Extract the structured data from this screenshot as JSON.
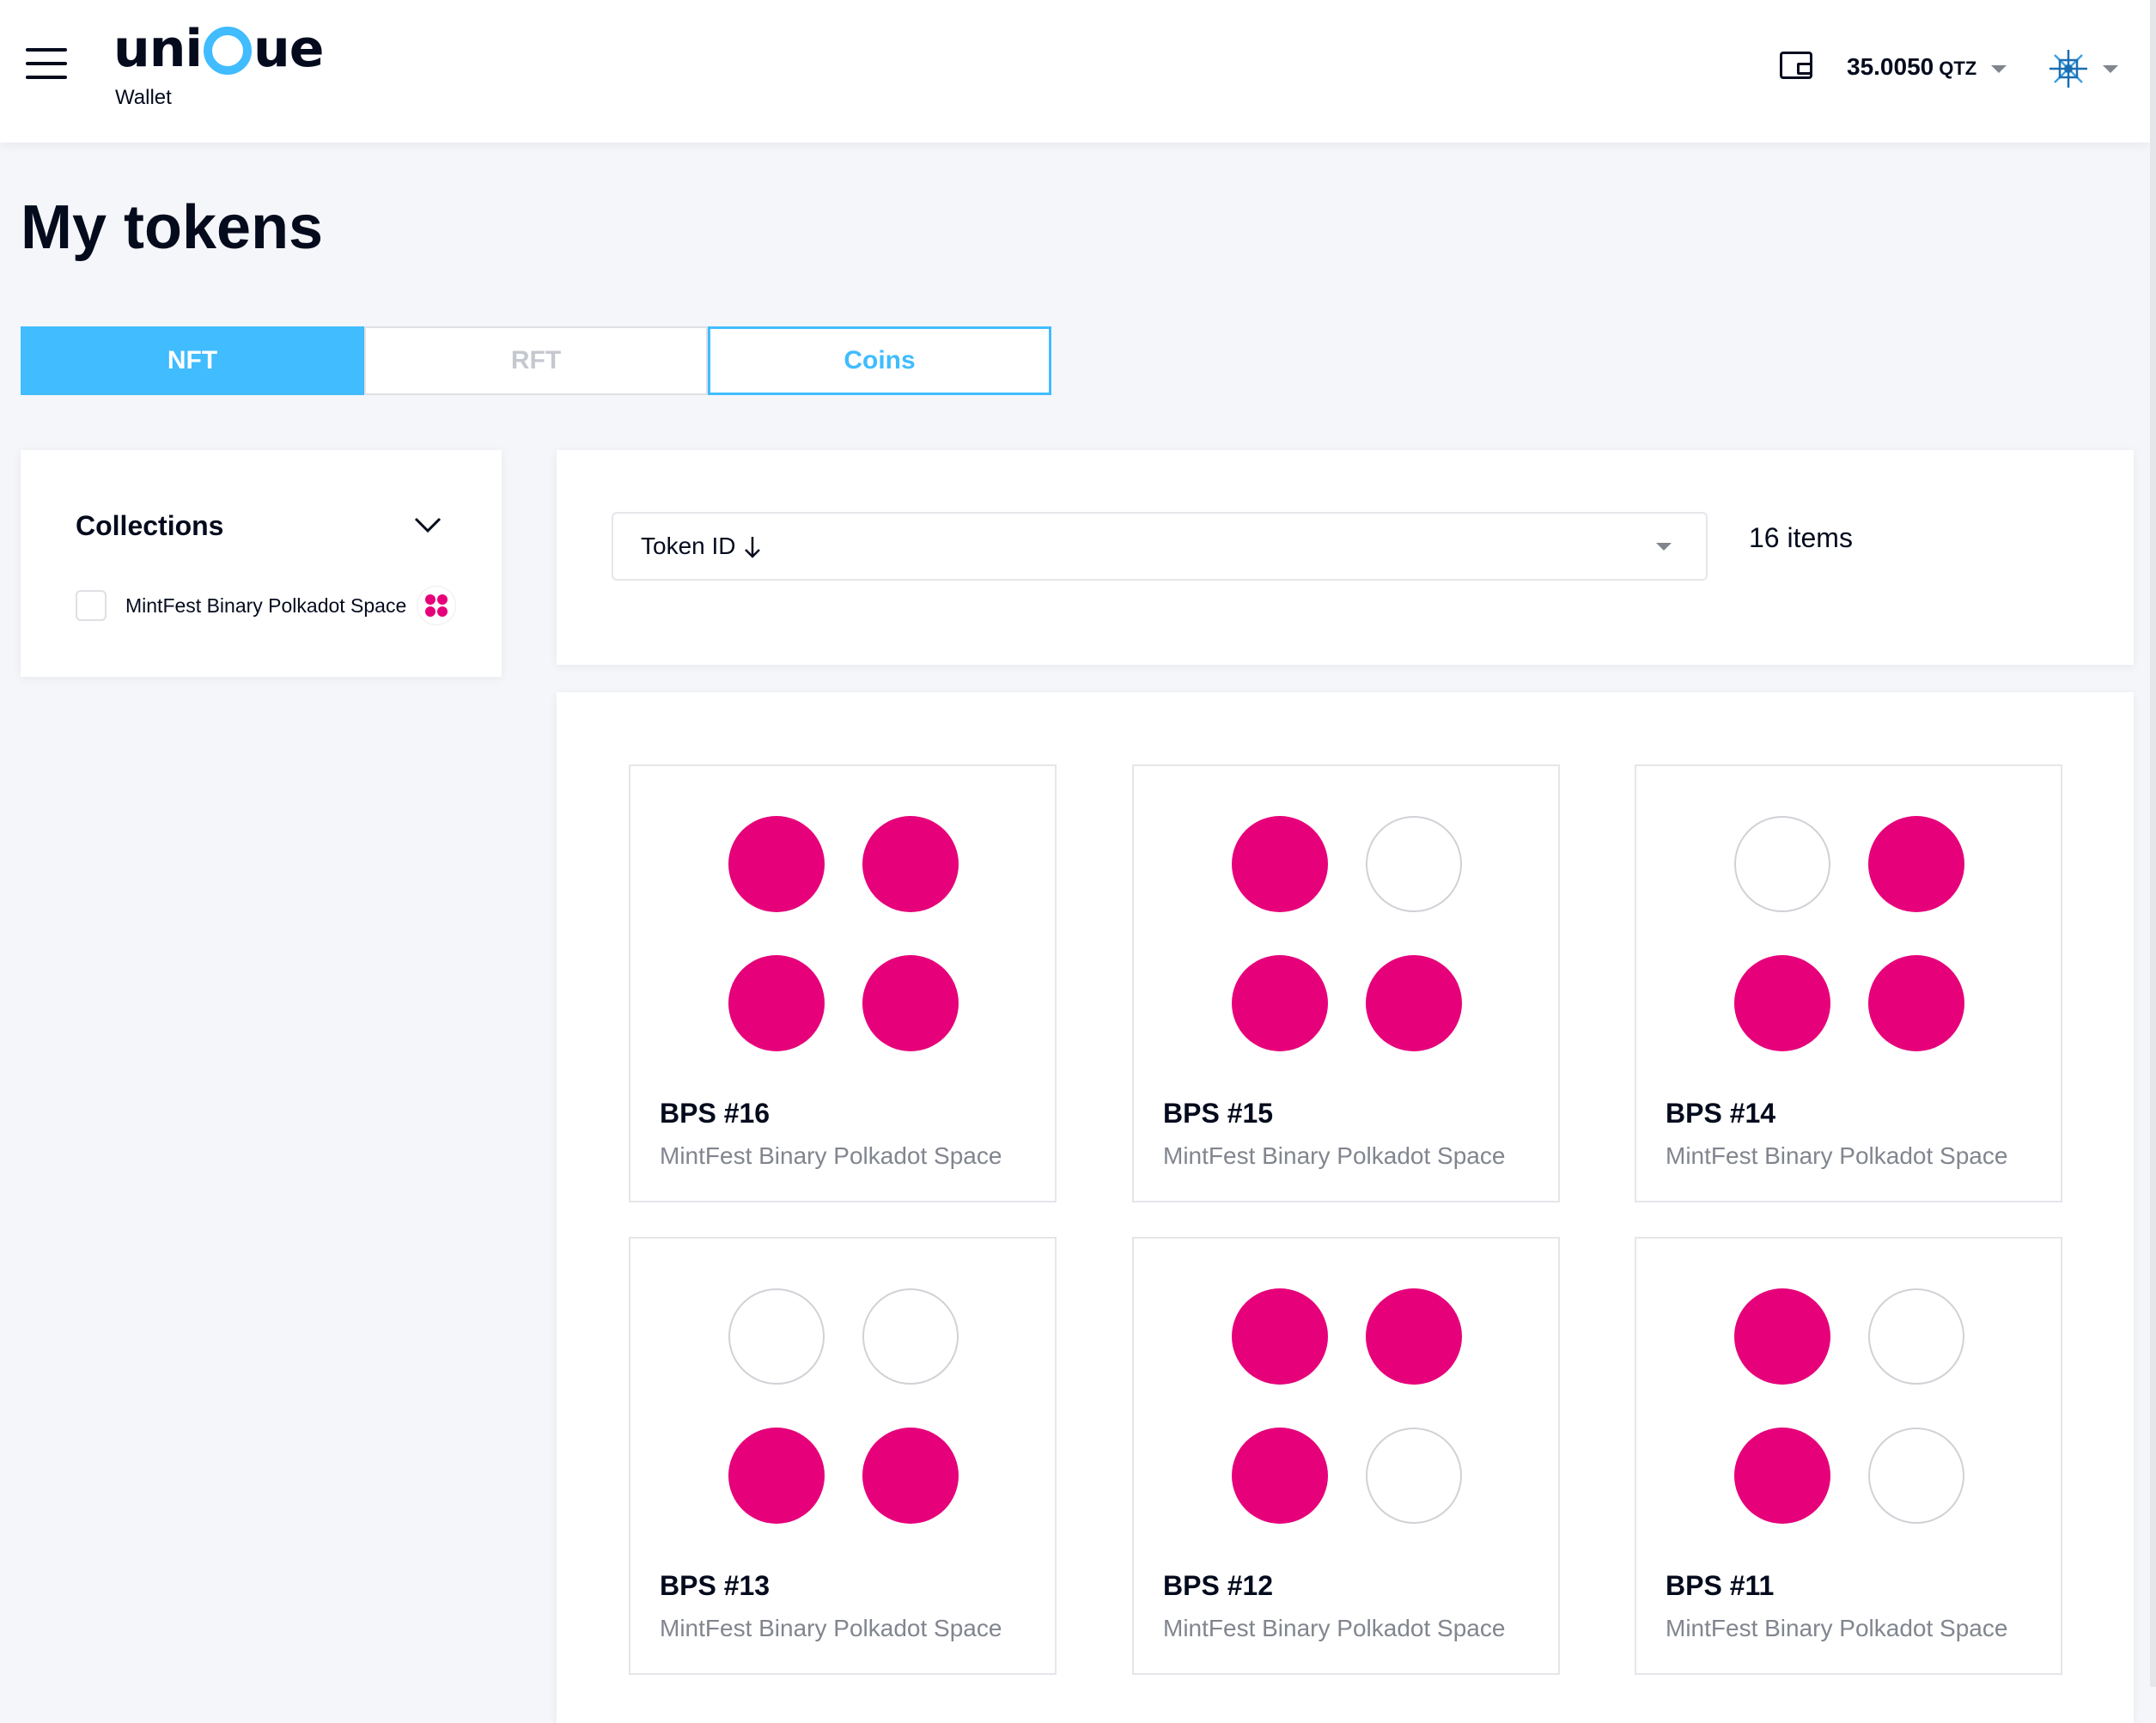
{
  "header": {
    "logo_text_left": "uni",
    "logo_text_right": "ue",
    "logo_sub": "Wallet",
    "balance": "35.0050",
    "balance_unit": "QTZ"
  },
  "page": {
    "title": "My tokens"
  },
  "tabs": [
    {
      "label": "NFT",
      "state": "active"
    },
    {
      "label": "RFT",
      "state": "disabled"
    },
    {
      "label": "Coins",
      "state": "default"
    }
  ],
  "collections": {
    "title": "Collections",
    "items": [
      {
        "label": "MintFest Binary Polkadot Space",
        "checked": false
      }
    ]
  },
  "sort": {
    "label": "Token ID",
    "direction": "descending"
  },
  "items_count": "16 items",
  "colors": {
    "accent": "#40bcff",
    "polkadot_pink": "#e6007a",
    "text": "#040b1d",
    "muted": "#81858e"
  },
  "tokens": [
    {
      "title": "BPS #16",
      "collection": "MintFest Binary Polkadot Space",
      "dots": [
        1,
        1,
        1,
        1
      ]
    },
    {
      "title": "BPS #15",
      "collection": "MintFest Binary Polkadot Space",
      "dots": [
        1,
        0,
        1,
        1
      ]
    },
    {
      "title": "BPS #14",
      "collection": "MintFest Binary Polkadot Space",
      "dots": [
        0,
        1,
        1,
        1
      ]
    },
    {
      "title": "BPS #13",
      "collection": "MintFest Binary Polkadot Space",
      "dots": [
        0,
        0,
        1,
        1
      ]
    },
    {
      "title": "BPS #12",
      "collection": "MintFest Binary Polkadot Space",
      "dots": [
        1,
        1,
        1,
        0
      ]
    },
    {
      "title": "BPS #11",
      "collection": "MintFest Binary Polkadot Space",
      "dots": [
        1,
        0,
        1,
        0
      ]
    }
  ]
}
